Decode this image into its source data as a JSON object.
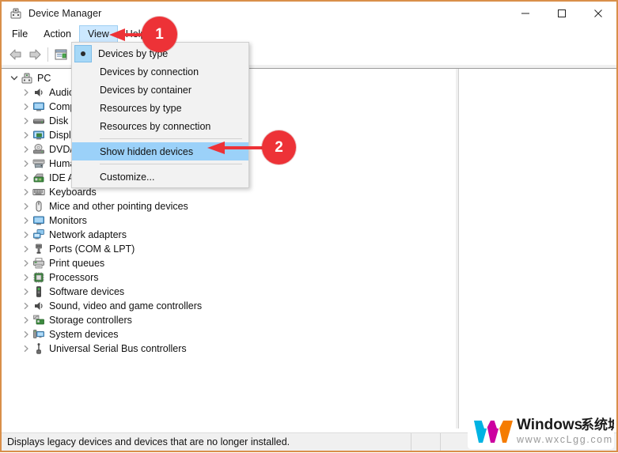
{
  "window": {
    "title": "Device Manager",
    "icon": "device-manager-icon",
    "border_color": "#d98f4a",
    "controls": {
      "minimize": "–",
      "maximize": "□",
      "close": "✕"
    }
  },
  "menubar": {
    "items": [
      {
        "label": "File",
        "state": "normal"
      },
      {
        "label": "Action",
        "state": "normal"
      },
      {
        "label": "View",
        "state": "open"
      },
      {
        "label": "Help",
        "state": "normal"
      }
    ]
  },
  "toolbar": {
    "buttons": [
      {
        "name": "back-button",
        "icon": "arrow-left-icon"
      },
      {
        "name": "forward-button",
        "icon": "arrow-right-icon"
      },
      {
        "name": "properties-button",
        "icon": "properties-icon"
      }
    ]
  },
  "view_menu": {
    "items": [
      {
        "label": "Devices by type",
        "checked": true,
        "selected": false,
        "separator_after": false
      },
      {
        "label": "Devices by connection",
        "checked": false,
        "selected": false,
        "separator_after": false
      },
      {
        "label": "Devices by container",
        "checked": false,
        "selected": false,
        "separator_after": false
      },
      {
        "label": "Resources by type",
        "checked": false,
        "selected": false,
        "separator_after": false
      },
      {
        "label": "Resources by connection",
        "checked": false,
        "selected": false,
        "separator_after": true
      },
      {
        "label": "Show hidden devices",
        "checked": false,
        "selected": true,
        "separator_after": true
      },
      {
        "label": "Customize...",
        "checked": false,
        "selected": false,
        "separator_after": false
      }
    ]
  },
  "tree": {
    "root": {
      "label": "PC",
      "icon": "computer-icon",
      "expanded": true
    },
    "items": [
      {
        "label": "Audio inputs and outputs",
        "icon": "speaker-icon"
      },
      {
        "label": "Computer",
        "icon": "monitor-icon"
      },
      {
        "label": "Disk drives",
        "icon": "disk-icon"
      },
      {
        "label": "Display adapters",
        "icon": "display-adapter-icon"
      },
      {
        "label": "DVD/CD-ROM drives",
        "icon": "dvd-icon"
      },
      {
        "label": "Human Interface Devices",
        "icon": "hid-icon"
      },
      {
        "label": "IDE ATA/ATAPI controllers",
        "icon": "ide-icon"
      },
      {
        "label": "Keyboards",
        "icon": "keyboard-icon"
      },
      {
        "label": "Mice and other pointing devices",
        "icon": "mouse-icon"
      },
      {
        "label": "Monitors",
        "icon": "monitor-icon"
      },
      {
        "label": "Network adapters",
        "icon": "network-icon"
      },
      {
        "label": "Ports (COM & LPT)",
        "icon": "port-icon"
      },
      {
        "label": "Print queues",
        "icon": "printer-icon"
      },
      {
        "label": "Processors",
        "icon": "processor-icon"
      },
      {
        "label": "Software devices",
        "icon": "software-device-icon"
      },
      {
        "label": "Sound, video and game controllers",
        "icon": "sound-icon"
      },
      {
        "label": "Storage controllers",
        "icon": "storage-icon"
      },
      {
        "label": "System devices",
        "icon": "system-device-icon"
      },
      {
        "label": "Universal Serial Bus controllers",
        "icon": "usb-icon"
      }
    ]
  },
  "statusbar": {
    "text": "Displays legacy devices and devices that are no longer installed."
  },
  "annotations": {
    "color": "#ed3237",
    "steps": [
      {
        "number": "1",
        "target": "view-menu"
      },
      {
        "number": "2",
        "target": "show-hidden-devices"
      }
    ]
  },
  "watermark": {
    "brand": "Windows系统城",
    "url": "www.wxcLgg.com"
  }
}
